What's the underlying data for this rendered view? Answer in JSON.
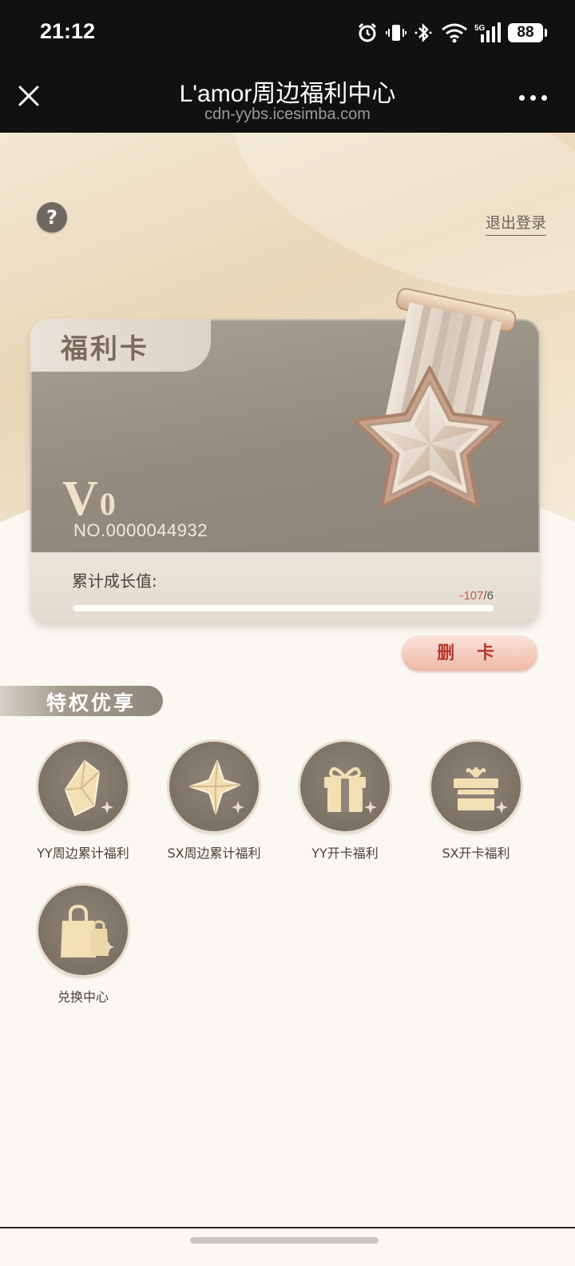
{
  "status_bar": {
    "time": "21:12",
    "battery": "88",
    "network": "5G"
  },
  "title_bar": {
    "title": "L'amor周边福利中心",
    "url": "cdn-yybs.icesimba.com",
    "close_icon": "close-icon",
    "more_icon": "more-icon"
  },
  "header": {
    "help_icon": "?",
    "logout": "退出登录"
  },
  "card": {
    "tab_title": "福利卡",
    "level_letter": "V",
    "level_number": "0",
    "card_no": "NO.0000044932",
    "growth_label": "累计成长值:",
    "growth_current": "-107",
    "growth_total": "/6",
    "growth_progress": 0,
    "delete_button": "删 卡"
  },
  "section": {
    "title": "特权优享"
  },
  "privileges": [
    {
      "label": "YY周边累计福利",
      "icon": "gem-icon"
    },
    {
      "label": "SX周边累计福利",
      "icon": "star-crystal-icon"
    },
    {
      "label": "YY开卡福利",
      "icon": "gift-box-icon"
    },
    {
      "label": "SX开卡福利",
      "icon": "gift-open-icon"
    },
    {
      "label": "兑换中心",
      "icon": "shopping-bag-icon"
    }
  ],
  "colors": {
    "accent_gold": "#f0d9a8",
    "card_taupe": "#948b80",
    "delete_red": "#b5372e",
    "negative_value": "#c9594b"
  }
}
